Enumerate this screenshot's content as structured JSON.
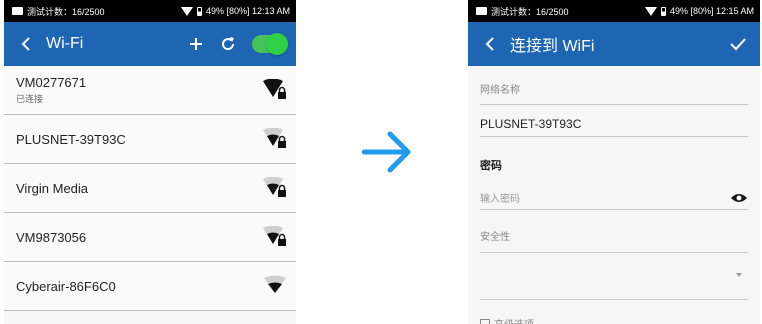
{
  "left": {
    "status": {
      "left_text": "测试计数：16/2500",
      "right_text": "49% [80%] 12:13 AM"
    },
    "header": {
      "title": "Wi-Fi"
    },
    "networks": [
      {
        "ssid": "VM0277671",
        "subtitle": "已连接",
        "signal": "full",
        "locked": true
      },
      {
        "ssid": "PLUSNET-39T93C",
        "signal": "medium",
        "locked": true
      },
      {
        "ssid": "Virgin Media",
        "signal": "medium",
        "locked": true
      },
      {
        "ssid": "VM9873056",
        "signal": "medium",
        "locked": true
      },
      {
        "ssid": "Cyberair-86F6C0",
        "signal": "medium",
        "locked": false
      }
    ]
  },
  "right": {
    "status": {
      "left_text": "测试计数：16/2500",
      "right_text": "49% [80%] 12:15 AM"
    },
    "header": {
      "title": "连接到 WiFi"
    },
    "form": {
      "network_name_label": "网络名称",
      "network_name_value": "PLUSNET-39T93C",
      "password_label": "密码",
      "password_placeholder": "输入密码",
      "security_label": "安全性",
      "advanced_label": "高级选项。"
    }
  },
  "colors": {
    "appbar": "#1e65b4",
    "toggle": "#2ed046",
    "arrow": "#1e9cf0"
  },
  "icons": [
    "back-arrow-icon",
    "add-icon",
    "refresh-icon",
    "wifi-lock-icon",
    "wifi-icon",
    "check-icon",
    "eye-icon",
    "dropdown-icon",
    "right-arrow-icon"
  ]
}
